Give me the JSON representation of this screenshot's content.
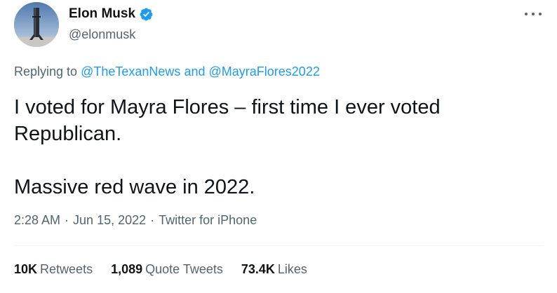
{
  "author": {
    "display_name": "Elon Musk",
    "handle": "@elonmusk",
    "verified": true,
    "avatar_icon": "rocket-booster-avatar"
  },
  "reply": {
    "prefix": "Replying to",
    "mention_1": "@TheTexanNews",
    "conjunction": "and",
    "mention_2": "@MayraFlores2022"
  },
  "tweet": {
    "line_1": "I voted for Mayra Flores – first time I ever voted",
    "line_2": "Republican.",
    "line_3": "Massive red wave in 2022."
  },
  "meta": {
    "time": "2:28 AM",
    "date": "Jun 15, 2022",
    "separator": "·",
    "source": "Twitter for iPhone"
  },
  "stats": {
    "retweets_count": "10K",
    "retweets_label": "Retweets",
    "quotes_count": "1,089",
    "quotes_label": "Quote Tweets",
    "likes_count": "73.4K",
    "likes_label": "Likes"
  },
  "colors": {
    "text_primary": "#0f1419",
    "text_secondary": "#536471",
    "accent": "#1d9bf0",
    "divider": "#eff3f4"
  }
}
